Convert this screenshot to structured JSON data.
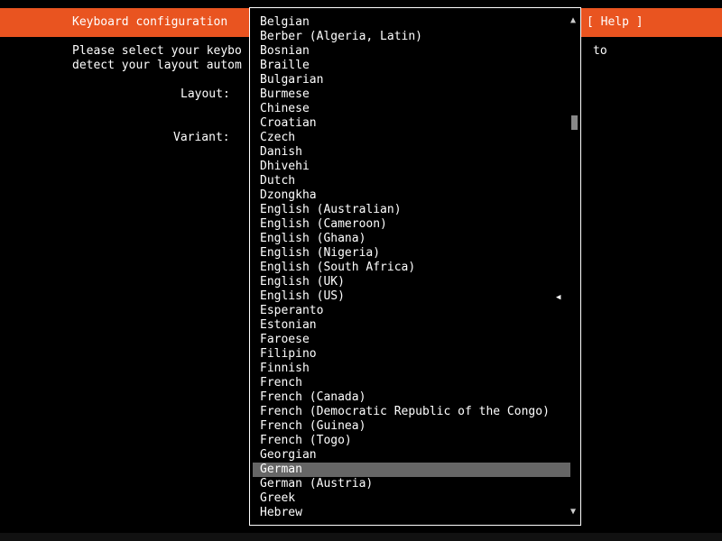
{
  "header": {
    "title": "Keyboard configuration",
    "help_label": "[ Help ]"
  },
  "background_text": {
    "line1_left": "Please select your keybo",
    "line1_right": "to",
    "line2_left": "detect your layout autom",
    "layout_label": "Layout:",
    "variant_label": "Variant:"
  },
  "dropdown": {
    "selected_index": 31,
    "current_index": 19,
    "options": [
      "Belgian",
      "Berber (Algeria, Latin)",
      "Bosnian",
      "Braille",
      "Bulgarian",
      "Burmese",
      "Chinese",
      "Croatian",
      "Czech",
      "Danish",
      "Dhivehi",
      "Dutch",
      "Dzongkha",
      "English (Australian)",
      "English (Cameroon)",
      "English (Ghana)",
      "English (Nigeria)",
      "English (South Africa)",
      "English (UK)",
      "English (US)",
      "Esperanto",
      "Estonian",
      "Faroese",
      "Filipino",
      "Finnish",
      "French",
      "French (Canada)",
      "French (Democratic Republic of the Congo)",
      "French (Guinea)",
      "French (Togo)",
      "Georgian",
      "German",
      "German (Austria)",
      "Greek",
      "Hebrew"
    ]
  },
  "icons": {
    "scroll_up": "▲",
    "scroll_down": "▼",
    "current_marker": "◀"
  },
  "colors": {
    "header": "#e95420",
    "selection": "#666666",
    "background": "#000000"
  }
}
